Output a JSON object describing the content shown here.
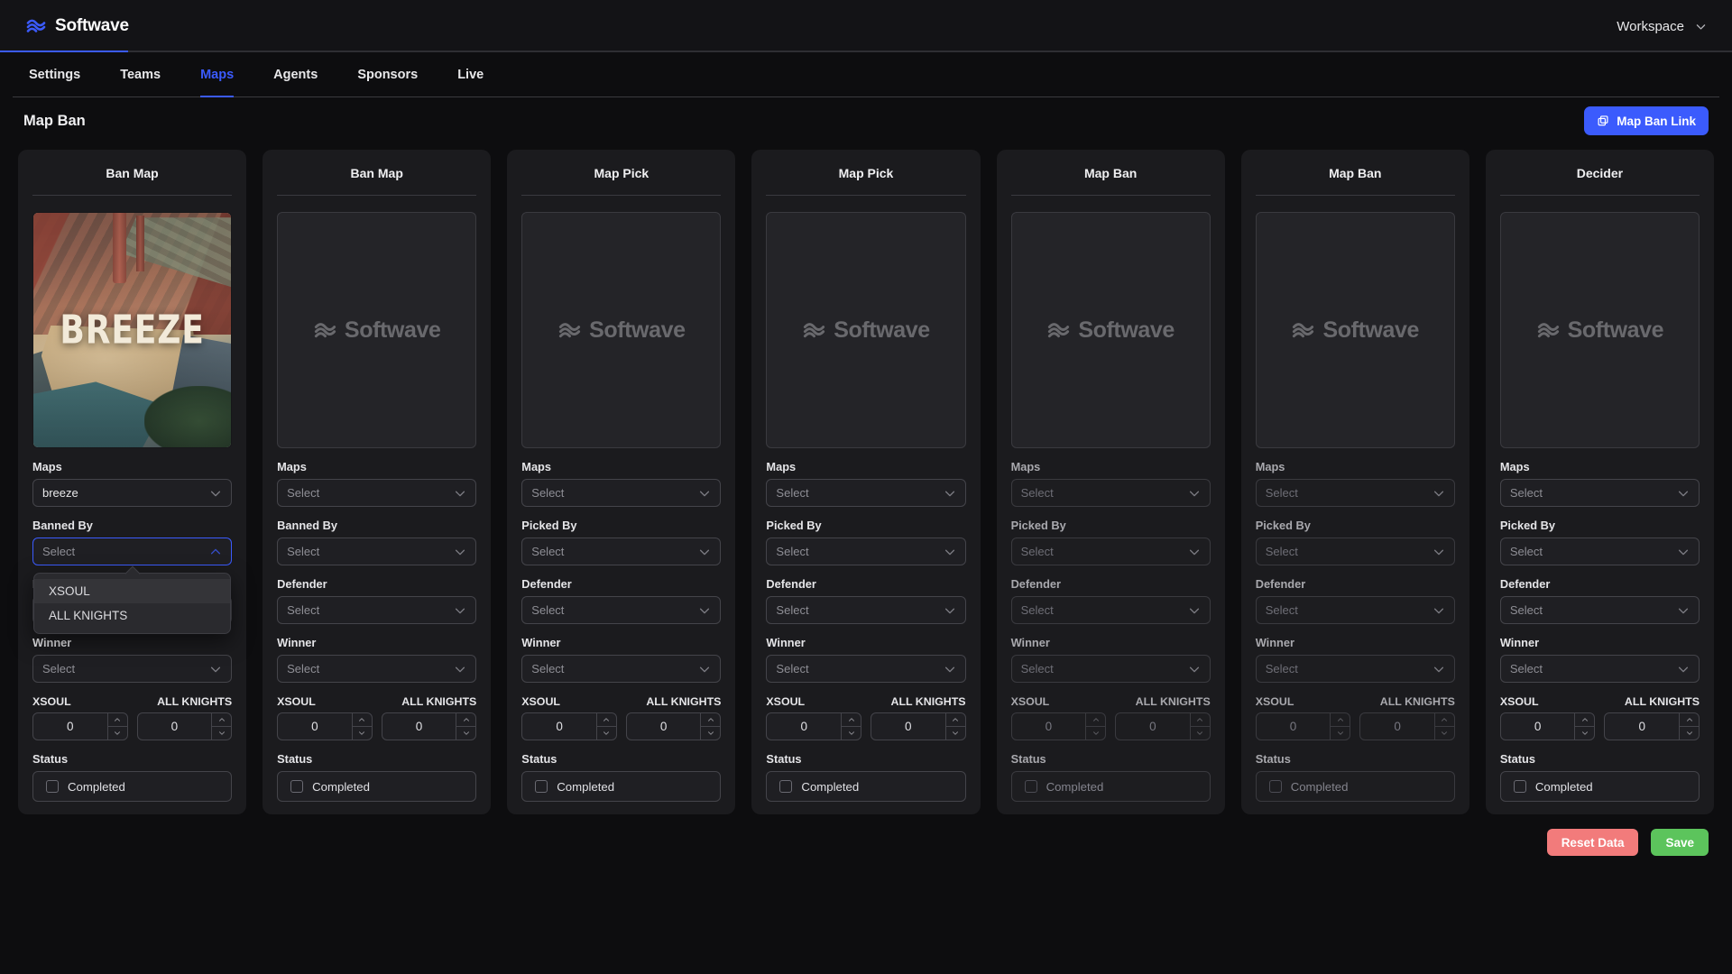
{
  "topbar": {
    "brand_name": "Softwave",
    "brand_logo_icon": "wave-logo-icon",
    "workspace_label": "Workspace",
    "workspace_chevron_icon": "chevron-down-icon"
  },
  "tabs": [
    {
      "label": "Settings",
      "active": false
    },
    {
      "label": "Teams",
      "active": false
    },
    {
      "label": "Maps",
      "active": true
    },
    {
      "label": "Agents",
      "active": false
    },
    {
      "label": "Sponsors",
      "active": false
    },
    {
      "label": "Live",
      "active": false
    }
  ],
  "page": {
    "title": "Map Ban",
    "map_ban_link_label": "Map Ban Link",
    "map_ban_link_icon": "copy-icon",
    "accent_color": "#3b5bfd"
  },
  "labels": {
    "maps": "Maps",
    "banned_by": "Banned By",
    "picked_by": "Picked By",
    "defender": "Defender",
    "winner": "Winner",
    "status": "Status",
    "completed": "Completed",
    "select_placeholder": "Select",
    "chevron_icon": "chevron-down-icon"
  },
  "teams": {
    "left": "XSOUL",
    "right": "ALL KNIGHTS"
  },
  "dropdown_options": [
    "XSOUL",
    "ALL KNIGHTS"
  ],
  "placeholder_logo": {
    "icon": "wave-logo-icon",
    "text": "Softwave"
  },
  "cards": [
    {
      "title": "Ban Map",
      "image": {
        "type": "map",
        "name": "BREEZE"
      },
      "maps_value": "breeze",
      "maps_filled": true,
      "actor_label": "Banned By",
      "actor_value": "Select",
      "actor_open": true,
      "defender_value": "Select",
      "winner_value": "Select",
      "score_left": "0",
      "score_right": "0",
      "completed": false,
      "disabled": false
    },
    {
      "title": "Ban Map",
      "image": {
        "type": "placeholder"
      },
      "maps_value": "Select",
      "maps_filled": false,
      "actor_label": "Banned By",
      "actor_value": "Select",
      "actor_open": false,
      "defender_value": "Select",
      "winner_value": "Select",
      "score_left": "0",
      "score_right": "0",
      "completed": false,
      "disabled": false
    },
    {
      "title": "Map Pick",
      "image": {
        "type": "placeholder"
      },
      "maps_value": "Select",
      "maps_filled": false,
      "actor_label": "Picked By",
      "actor_value": "Select",
      "actor_open": false,
      "defender_value": "Select",
      "winner_value": "Select",
      "score_left": "0",
      "score_right": "0",
      "completed": false,
      "disabled": false
    },
    {
      "title": "Map Pick",
      "image": {
        "type": "placeholder"
      },
      "maps_value": "Select",
      "maps_filled": false,
      "actor_label": "Picked By",
      "actor_value": "Select",
      "actor_open": false,
      "defender_value": "Select",
      "winner_value": "Select",
      "score_left": "0",
      "score_right": "0",
      "completed": false,
      "disabled": false
    },
    {
      "title": "Map Ban",
      "image": {
        "type": "placeholder"
      },
      "maps_value": "Select",
      "maps_filled": false,
      "actor_label": "Picked By",
      "actor_value": "Select",
      "actor_open": false,
      "defender_value": "Select",
      "winner_value": "Select",
      "score_left": "0",
      "score_right": "0",
      "completed": false,
      "disabled": true
    },
    {
      "title": "Map Ban",
      "image": {
        "type": "placeholder"
      },
      "maps_value": "Select",
      "maps_filled": false,
      "actor_label": "Picked By",
      "actor_value": "Select",
      "actor_open": false,
      "defender_value": "Select",
      "winner_value": "Select",
      "score_left": "0",
      "score_right": "0",
      "completed": false,
      "disabled": true
    },
    {
      "title": "Decider",
      "image": {
        "type": "placeholder"
      },
      "maps_value": "Select",
      "maps_filled": false,
      "actor_label": "Picked By",
      "actor_value": "Select",
      "actor_open": false,
      "defender_value": "Select",
      "winner_value": "Select",
      "score_left": "0",
      "score_right": "0",
      "completed": false,
      "disabled": false
    }
  ],
  "footer": {
    "reset_label": "Reset Data",
    "save_label": "Save",
    "reset_color": "#f27b7b",
    "save_color": "#5cc45c"
  }
}
